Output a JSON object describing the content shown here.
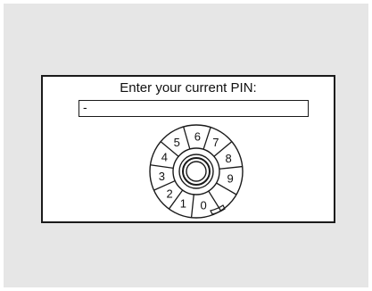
{
  "dialog": {
    "prompt": "Enter your current PIN:",
    "pin_value": "-"
  },
  "dial": {
    "digits": [
      "0",
      "1",
      "2",
      "3",
      "4",
      "5",
      "6",
      "7",
      "8",
      "9"
    ],
    "icon": "rotary-dial-icon"
  },
  "colors": {
    "background": "#e6e6e6",
    "dialog_bg": "#ffffff",
    "ink": "#1a1a1a"
  }
}
